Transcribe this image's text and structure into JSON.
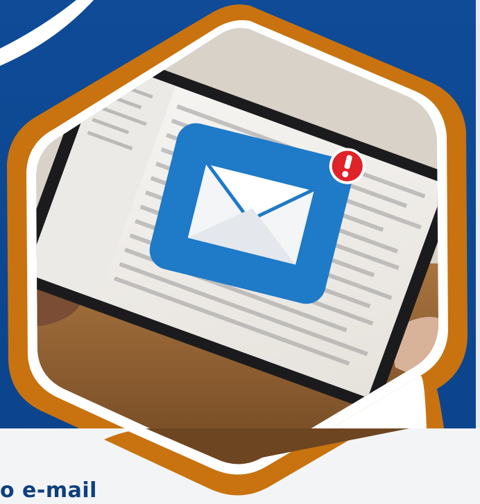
{
  "caption": {
    "text": "o e-mail"
  },
  "graphic": {
    "subject": "tablet-with-email-notification",
    "alert_symbol": "!"
  },
  "colors": {
    "background_blue": "#0e4a94",
    "hex_border_orange": "#c8730f",
    "hex_border_white": "#ffffff",
    "envelope_tile_blue": "#1f7ac8",
    "alert_red": "#e02229",
    "caption_text": "#0e3f7e",
    "bottom_panel": "#f3f4f6"
  }
}
